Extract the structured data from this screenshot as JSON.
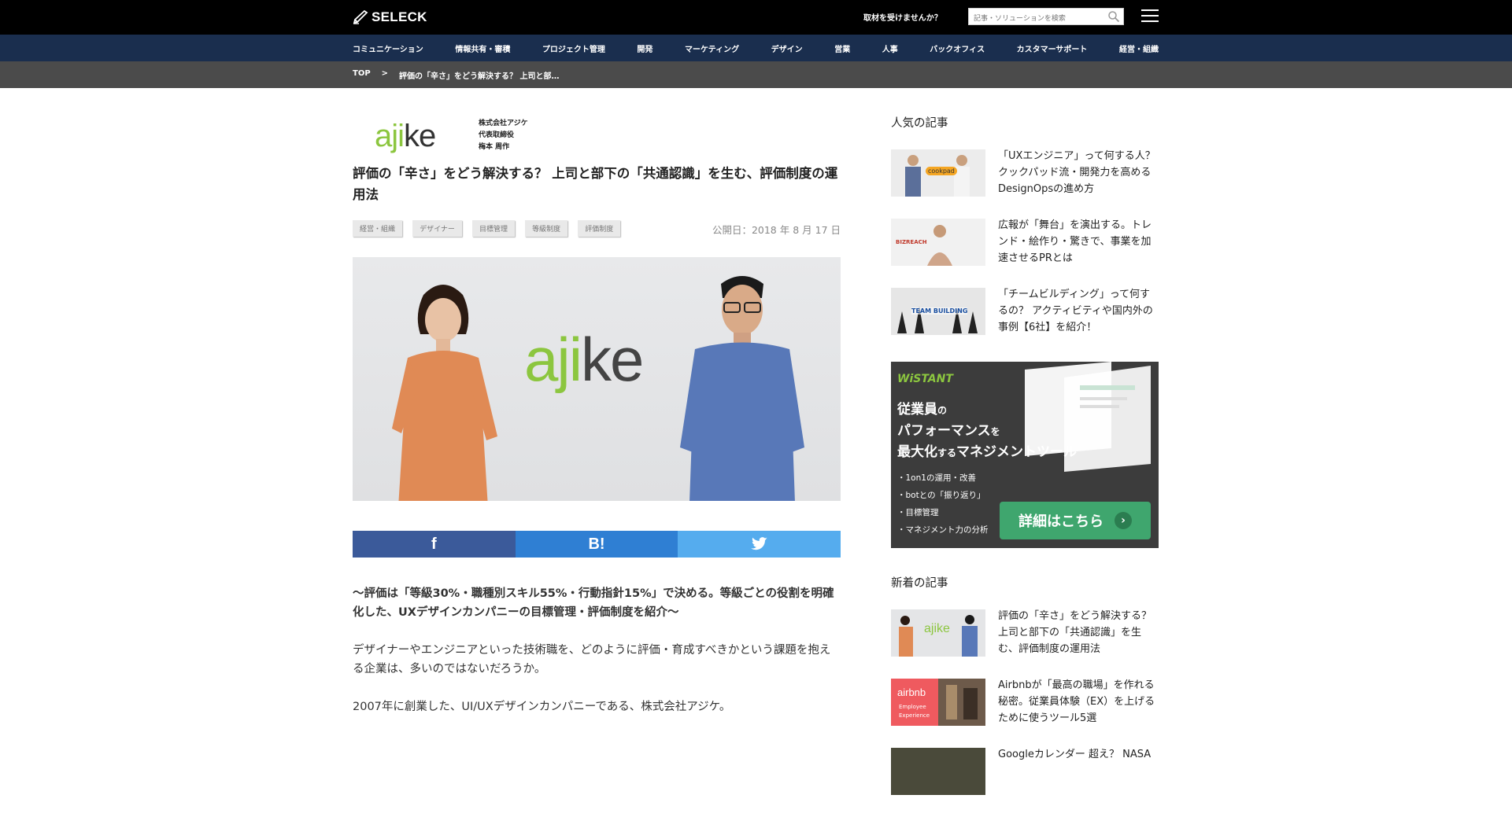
{
  "header": {
    "logo_text": "SELECK",
    "interview_link": "取材を受けませんか？",
    "search_placeholder": "記事・ソリューションを検索"
  },
  "categories": [
    "コミュニケーション",
    "情報共有・審積",
    "プロジェクト管理",
    "開発",
    "マーケティング",
    "デザイン",
    "営業",
    "人事",
    "バックオフィス",
    "カスタマーサポート",
    "経営・組織"
  ],
  "breadcrumb": {
    "top": "TOP",
    "separator": ">",
    "current": "評価の「辛さ」をどう解決する？ 上司と部…"
  },
  "article": {
    "company_logo_a": "aji",
    "company_logo_b": "ke",
    "company_name": "株式会社アジケ",
    "company_role": "代表取締役",
    "company_person": "梅本 周作",
    "title": "評価の「辛さ」をどう解決する？ 上司と部下の「共通認識」を生む、評価制度の運用法",
    "tags": [
      "経営・組織",
      "デザイナー",
      "目標管理",
      "等級制度",
      "評価制度"
    ],
    "published": "公開日：2018 年 8 月 17 日",
    "hero_logo_a": "aji",
    "hero_logo_b": "ke",
    "share": {
      "facebook": "f",
      "hatena": "B!",
      "twitter": "t"
    },
    "lead": "〜評価は「等級30%・職種別スキル55%・行動指針15%」で決める。等級ごとの役割を明確化した、UXデザインカンパニーの目標管理・評価制度を紹介〜",
    "paragraphs": [
      "デザイナーやエンジニアといった技術職を、どのように評価・育成すべきかという課題を抱える企業は、多いのではないだろうか。",
      "2007年に創業した、UI/UXデザインカンパニーである、株式会社アジケ。"
    ]
  },
  "sidebar": {
    "popular_heading": "人気の記事",
    "popular": [
      {
        "title": "「UXエンジニア」って何する人？ クックパッド流・開発力を高めるDesignOpsの進め方",
        "thumb_label": "cookpad"
      },
      {
        "title": "広報が「舞台」を演出する。トレンド・絵作り・驚きで、事業を加速させるPRとは",
        "thumb_label": "BIZREACH"
      },
      {
        "title": "「チームビルディング」って何するの？ アクティビティや国内外の事例【6社】を紹介！",
        "thumb_label": "TEAM BUILDING"
      }
    ],
    "ad": {
      "brand": "WiSTANT",
      "line1a": "従業員",
      "line1b": "の",
      "line2a": "パフォーマンス",
      "line2b": "を",
      "line3a": "最大化",
      "line3b": "する",
      "line3c": "マネジメントツール",
      "bullets": [
        "・1on1の運用・改善",
        "・botとの「振り返り」",
        "・目標管理",
        "・マネジメント力の分析"
      ],
      "cta": "詳細はこちら"
    },
    "new_heading": "新着の記事",
    "new_items": [
      {
        "title": "評価の「辛さ」をどう解決する？ 上司と部下の「共通認識」を生む、評価制度の運用法",
        "thumb_label": "ajike"
      },
      {
        "title": "Airbnbが「最高の職場」を作れる秘密。従業員体験（EX）を上げるために使うツール5選",
        "thumb_label": "airbnb",
        "thumb_sub1": "Employee",
        "thumb_sub2": "Experience"
      },
      {
        "title": "Googleカレンダー 超え？ NASA"
      }
    ]
  }
}
